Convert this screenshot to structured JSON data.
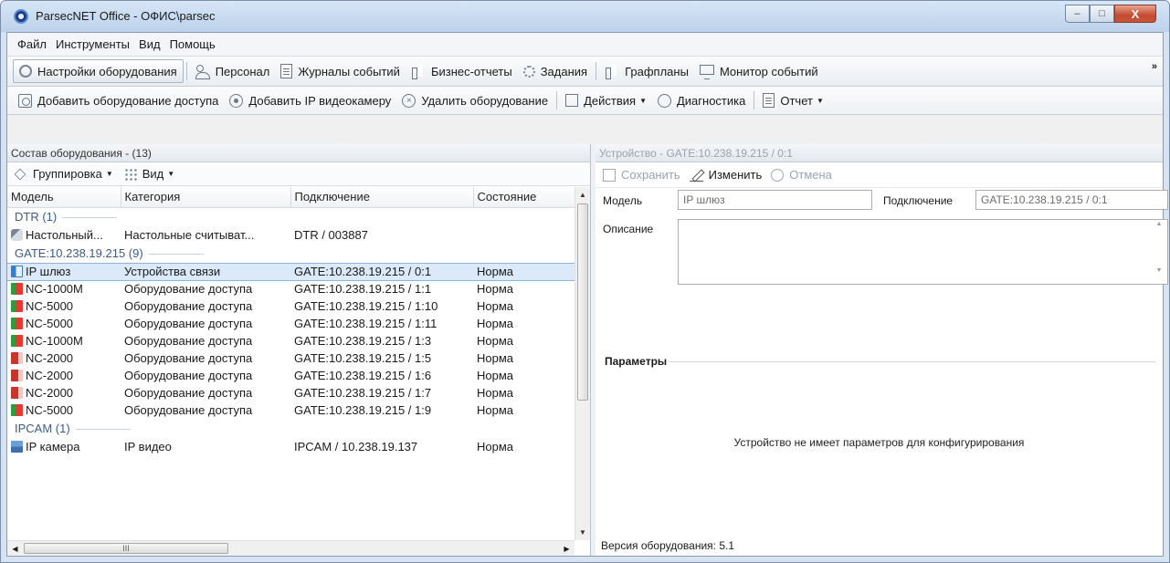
{
  "window": {
    "title": "ParsecNET Office - ОФИС\\parsec",
    "controls": {
      "minimize": "–",
      "maximize": "□",
      "close": "X"
    }
  },
  "menu": [
    "Файл",
    "Инструменты",
    "Вид",
    "Помощь"
  ],
  "main_toolbar": {
    "items": [
      {
        "label": "Настройки оборудования",
        "icon": "equipment-settings-icon",
        "active": true
      },
      {
        "label": "Персонал",
        "icon": "people-icon"
      },
      {
        "label": "Журналы событий",
        "icon": "journal-icon"
      },
      {
        "label": "Бизнес-отчеты",
        "icon": "reports-icon"
      },
      {
        "label": "Задания",
        "icon": "tasks-icon"
      },
      {
        "label": "Графпланы",
        "icon": "floorplan-icon"
      },
      {
        "label": "Монитор событий",
        "icon": "monitor-icon"
      }
    ],
    "overflow": "»"
  },
  "action_toolbar": {
    "add_access": "Добавить оборудование доступа",
    "add_camera": "Добавить IP видеокамеру",
    "delete": "Удалить оборудование",
    "actions": "Действия",
    "diagnostics": "Диагностика",
    "report": "Отчет",
    "dropdown_glyph": "▼"
  },
  "left_pane": {
    "header": "Состав оборудования - (13)",
    "grouping": "Группировка",
    "view": "Вид",
    "columns": [
      "Модель",
      "Категория",
      "Подключение",
      "Состояние"
    ],
    "groups": [
      {
        "label": "DTR (1)",
        "rows": [
          {
            "icon": "reader",
            "model": "Настольный...",
            "category": "Настольные считыват...",
            "connection": "DTR / 003887",
            "state": ""
          }
        ]
      },
      {
        "label": "GATE:10.238.19.215 (9)",
        "rows": [
          {
            "icon": "gate",
            "model": "IP шлюз",
            "category": "Устройства связи",
            "connection": "GATE:10.238.19.215 / 0:1",
            "state": "Норма",
            "selected": true
          },
          {
            "icon": "nc1000",
            "model": "NC-1000M",
            "category": "Оборудование доступа",
            "connection": "GATE:10.238.19.215 / 1:1",
            "state": "Норма"
          },
          {
            "icon": "nc1000",
            "model": "NC-5000",
            "category": "Оборудование доступа",
            "connection": "GATE:10.238.19.215 / 1:10",
            "state": "Норма"
          },
          {
            "icon": "nc1000",
            "model": "NC-5000",
            "category": "Оборудование доступа",
            "connection": "GATE:10.238.19.215 / 1:11",
            "state": "Норма"
          },
          {
            "icon": "nc1000",
            "model": "NC-1000M",
            "category": "Оборудование доступа",
            "connection": "GATE:10.238.19.215 / 1:3",
            "state": "Норма"
          },
          {
            "icon": "nc2000",
            "model": "NC-2000",
            "category": "Оборудование доступа",
            "connection": "GATE:10.238.19.215 / 1:5",
            "state": "Норма"
          },
          {
            "icon": "nc2000",
            "model": "NC-2000",
            "category": "Оборудование доступа",
            "connection": "GATE:10.238.19.215 / 1:6",
            "state": "Норма"
          },
          {
            "icon": "nc2000",
            "model": "NC-2000",
            "category": "Оборудование доступа",
            "connection": "GATE:10.238.19.215 / 1:7",
            "state": "Норма"
          },
          {
            "icon": "nc1000",
            "model": "NC-5000",
            "category": "Оборудование доступа",
            "connection": "GATE:10.238.19.215 / 1:9",
            "state": "Норма"
          }
        ]
      },
      {
        "label": "IPCAM (1)",
        "rows": [
          {
            "icon": "ipcam",
            "model": "IP камера",
            "category": "IP видео",
            "connection": "IPCAM / 10.238.19.137",
            "state": "Норма"
          }
        ]
      }
    ],
    "hscroll_grip": "III"
  },
  "right_pane": {
    "header": "Устройство - GATE:10.238.19.215 / 0:1",
    "save": "Сохранить",
    "edit": "Изменить",
    "cancel": "Отмена",
    "model_label": "Модель",
    "model_value": "IP шлюз",
    "connection_label": "Подключение",
    "connection_value": "GATE:10.238.19.215 / 0:1",
    "description_label": "Описание",
    "description_value": "",
    "params_label": "Параметры",
    "no_params": "Устройство не имеет параметров для конфигурирования",
    "version": "Версия оборудования: 5.1"
  }
}
